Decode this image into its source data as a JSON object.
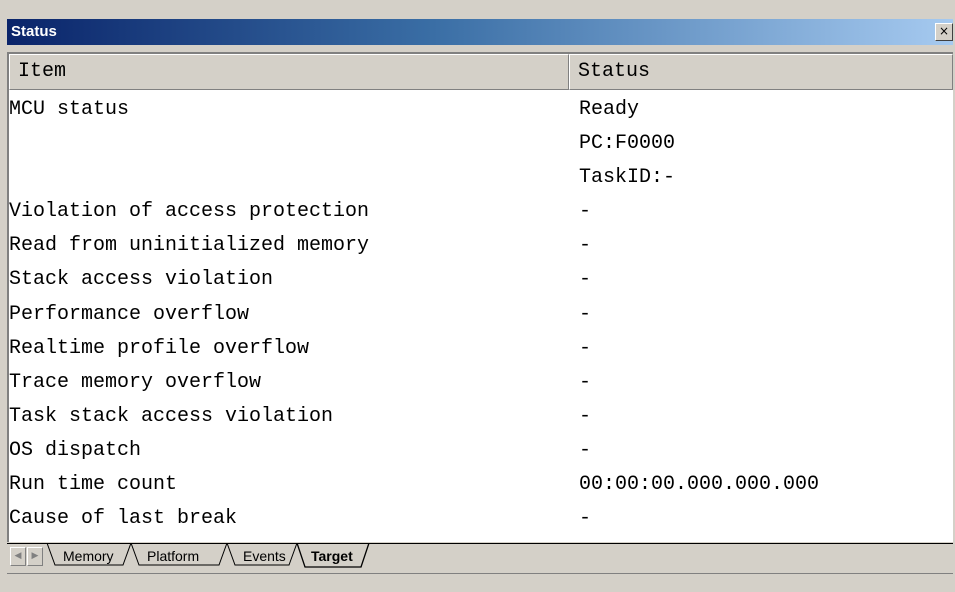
{
  "window": {
    "title": "Status",
    "close_glyph": "×"
  },
  "table": {
    "headers": {
      "item": "Item",
      "status": "Status"
    },
    "rows": [
      {
        "item": "MCU status",
        "status": "Ready"
      },
      {
        "item": "",
        "status": "PC:F0000"
      },
      {
        "item": "",
        "status": "TaskID:-"
      },
      {
        "item": "Violation of access protection",
        "status": "-"
      },
      {
        "item": "Read from uninitialized memory",
        "status": "-"
      },
      {
        "item": "Stack access violation",
        "status": "-"
      },
      {
        "item": "Performance overflow",
        "status": "-"
      },
      {
        "item": "Realtime profile overflow",
        "status": "-"
      },
      {
        "item": "Trace memory overflow",
        "status": "-"
      },
      {
        "item": "Task stack access violation",
        "status": "-"
      },
      {
        "item": "OS dispatch",
        "status": "-"
      },
      {
        "item": "Run time count",
        "status": "00:00:00.000.000.000"
      },
      {
        "item": "Cause of last break",
        "status": "-"
      }
    ]
  },
  "tabs": [
    {
      "label": "Memory",
      "active": false
    },
    {
      "label": "Platform",
      "active": false
    },
    {
      "label": "Events",
      "active": false
    },
    {
      "label": "Target",
      "active": true
    }
  ],
  "nav": {
    "left_glyph": "◀",
    "right_glyph": "▶"
  },
  "colors": {
    "title_gradient_start": "#0a246a",
    "title_gradient_end": "#a6caf0",
    "face": "#d4d0c8"
  }
}
